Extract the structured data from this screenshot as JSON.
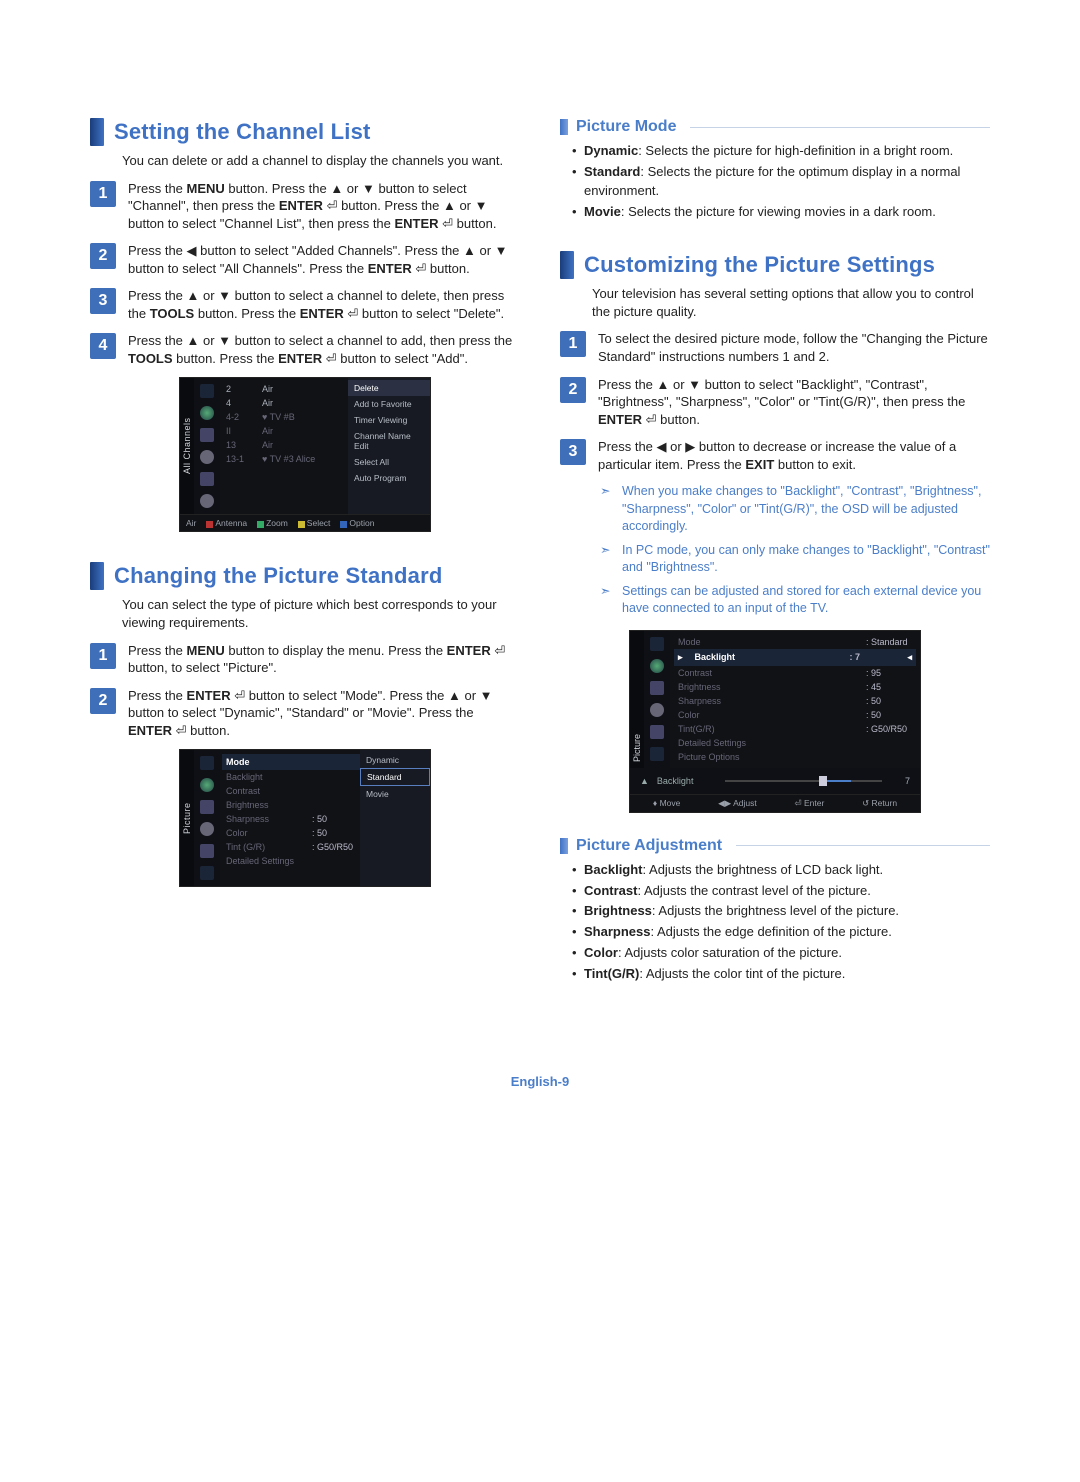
{
  "left": {
    "s1": {
      "title": "Setting the Channel List",
      "intro": "You can delete or add a channel to display the channels you want.",
      "step1": "Press the <b>MENU</b> button. Press the ▲ or ▼ button to select \"Channel\", then press the <b>ENTER</b> ⏎ button. Press the ▲ or ▼ button to select \"Channel List\", then press the <b>ENTER</b> ⏎ button.",
      "step2": "Press the ◀ button to select \"Added Channels\". Press the ▲ or ▼ button to select \"All Channels\". Press the <b>ENTER</b> ⏎ button.",
      "step3": "Press the ▲ or ▼ button to select a channel to delete, then press the <b>TOOLS</b> button. Press the <b>ENTER</b> ⏎ button to select \"Delete\".",
      "step4": "Press the ▲ or ▼ button to select a channel to add, then press the <b>TOOLS</b> button. Press the <b>ENTER</b> ⏎ button to select \"Add\".",
      "osd": {
        "label": "All Channels",
        "rows": [
          {
            "c1": "2",
            "c2": "Air"
          },
          {
            "c1": "4",
            "c2": "Air"
          },
          {
            "c1": "4-2",
            "c2": "♥ TV #B"
          },
          {
            "c1": "II",
            "c2": "Air"
          },
          {
            "c1": "13",
            "c2": "Air"
          },
          {
            "c1": "13-1",
            "c2": "♥ TV #3   Alice"
          }
        ],
        "menu": [
          "Delete",
          "Add to Favorite",
          "Timer Viewing",
          "Channel Name Edit",
          "Select All",
          "Auto Program"
        ],
        "foot": [
          "Air",
          "Antenna",
          "Zoom",
          "Select",
          "Option"
        ]
      }
    },
    "s2": {
      "title": "Changing the Picture Standard",
      "intro": "You can select the type of picture which best corresponds to your viewing requirements.",
      "step1": "Press the <b>MENU</b> button to display the menu. Press the <b>ENTER</b> ⏎ button, to select \"Picture\".",
      "step2": "Press the <b>ENTER</b> ⏎ button to select \"Mode\". Press the ▲ or ▼ button to select \"Dynamic\", \"Standard\" or \"Movie\". Press the <b>ENTER</b> ⏎ button.",
      "osd": {
        "label": "Picture",
        "rows": [
          {
            "n": "Mode",
            "v": "",
            "hl": true
          },
          {
            "n": "Backlight",
            "v": ""
          },
          {
            "n": "Contrast",
            "v": ""
          },
          {
            "n": "Brightness",
            "v": ""
          },
          {
            "n": "Sharpness",
            "v": ": 50"
          },
          {
            "n": "Color",
            "v": ": 50"
          },
          {
            "n": "Tint (G/R)",
            "v": ": G50/R50"
          },
          {
            "n": "Detailed Settings",
            "v": ""
          }
        ],
        "popup": [
          "Dynamic",
          "Standard",
          "Movie"
        ]
      }
    }
  },
  "right": {
    "s1": {
      "title": "Picture Mode",
      "items": [
        "<b>Dynamic</b>: Selects the picture for high-definition in a bright room.",
        "<b>Standard</b>: Selects the picture for the optimum display in a normal environment.",
        "<b>Movie</b>: Selects the picture for viewing movies in a dark room."
      ]
    },
    "s2": {
      "title": "Customizing the Picture Settings",
      "intro": "Your television has several setting options that allow you to control the picture quality.",
      "step1": "To select the desired picture mode, follow the \"Changing the Picture Standard\" instructions numbers 1 and 2.",
      "step2": "Press the ▲ or ▼ button to select \"Backlight\", \"Contrast\", \"Brightness\", \"Sharpness\", \"Color\" or \"Tint(G/R)\", then press the <b>ENTER</b> ⏎ button.",
      "step3": "Press the ◀ or ▶ button to decrease or increase the value of a particular item. Press the <b>EXIT</b> button to exit.",
      "notes": [
        "When you make changes to \"Backlight\", \"Contrast\", \"Brightness\", \"Sharpness\", \"Color\" or \"Tint(G/R)\", the OSD will be adjusted accordingly.",
        "In PC mode, you can only make changes to \"Backlight\", \"Contrast\" and \"Brightness\".",
        "Settings can be adjusted and stored for each external device you have connected to an input of the TV."
      ],
      "osd": {
        "label": "Picture",
        "rows": [
          {
            "n": "Mode",
            "v": ": Standard"
          },
          {
            "n": "Backlight",
            "v": ": 7",
            "hl": true
          },
          {
            "n": "Contrast",
            "v": ": 95"
          },
          {
            "n": "Brightness",
            "v": ": 45"
          },
          {
            "n": "Sharpness",
            "v": ": 50"
          },
          {
            "n": "Color",
            "v": ": 50"
          },
          {
            "n": "Tint(G/R)",
            "v": ": G50/R50"
          },
          {
            "n": "Detailed Settings",
            "v": ""
          },
          {
            "n": "Picture Options",
            "v": ""
          }
        ],
        "slider": {
          "label": "Backlight",
          "val": "7",
          "arrow": "▲"
        },
        "foot": [
          "♦ Move",
          "◀▶ Adjust",
          "⏎ Enter",
          "↺ Return"
        ]
      }
    },
    "s3": {
      "title": "Picture Adjustment",
      "items": [
        "<b>Backlight</b>: Adjusts the brightness of LCD back light.",
        "<b>Contrast</b>: Adjusts the contrast level of the picture.",
        "<b>Brightness</b>: Adjusts the brightness level of the picture.",
        "<b>Sharpness</b>: Adjusts the edge definition of the picture.",
        "<b>Color</b>: Adjusts color saturation of the picture.",
        "<b>Tint(G/R)</b>: Adjusts the color tint of the picture."
      ]
    }
  },
  "footer": "English-9"
}
